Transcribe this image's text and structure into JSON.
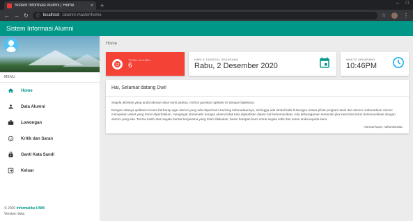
{
  "browser": {
    "tab_title": "Sistem Informasi Alumni | Home",
    "tab_close": "×",
    "new_tab": "+",
    "url_host": "localhost",
    "url_path": "/alumni-master/home"
  },
  "app": {
    "title": "Sistem Informasi Alumni"
  },
  "sidebar": {
    "menu_header": "MENU",
    "items": [
      {
        "label": "Home",
        "icon": "home-icon"
      },
      {
        "label": "Data Alumni",
        "icon": "person-icon"
      },
      {
        "label": "Lowongan",
        "icon": "briefcase-icon"
      },
      {
        "label": "Kritik dan Saran",
        "icon": "chat-icon"
      },
      {
        "label": "Ganti Kata Sandi",
        "icon": "lock-icon"
      },
      {
        "label": "Keluar",
        "icon": "logout-icon"
      }
    ],
    "footer": {
      "copyright_prefix": "© 2020",
      "brand": "Informatika UNIB",
      "version": "Version: beta"
    }
  },
  "main": {
    "breadcrumb": "Home",
    "cards": {
      "alumni": {
        "label": "TOTAL ALUMNI",
        "value": "6",
        "color": "#f44336"
      },
      "date": {
        "label": "HARI & TANGGAL SEKARANG",
        "value": "Rabu, 2 Desember 2020",
        "icon_color": "#009688"
      },
      "time": {
        "label": "WAKTU SEKARANG",
        "value": "10:46PM",
        "icon_color": "#03a9f4"
      }
    },
    "panel": {
      "greeting": "Hai, Selamat datang Dwi!",
      "para1": "Segala aktivitas yang anda lakukan akan kami pantau, mohon gunakan aplikasi ini dengan bijaksana.",
      "para2": "Dengan adanya aplikasi ini kami berharap agar alumni yang ada dapat kami tracking keberadaannya, sehingga ada timbal balik hubungan antara pihak program studi dan alumni. Keberadaan Alumni merupakan asset yang harus diperhatikan, mengingat almamater dengan alumni tidak bisa dipisahkan dalam hal berkomunikasi. Ada keberagaman tersendiri jika kami bisa terus berkomunikasi dengan alumni yang ada. Terima kasih atas segala bentuk kerjasama yang telah dilakukan, besar harapan kami untuk segala kritik dan saran anda kepada kami.",
      "signature": "Hormat kami, Administrator."
    }
  },
  "colors": {
    "primary": "#009688",
    "danger": "#f44336"
  }
}
